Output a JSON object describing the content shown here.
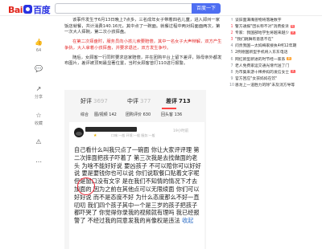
{
  "header": {
    "logo_bai": "Bai",
    "logo_du": "百度",
    "search_button": "百度一下"
  },
  "sidebar": {
    "items": [
      {
        "icon": "like-icon",
        "label": "64"
      },
      {
        "icon": "comment-icon",
        "label": ""
      },
      {
        "icon": "share-icon",
        "label": "分享"
      },
      {
        "icon": "star-icon",
        "label": "收藏"
      },
      {
        "icon": "report-icon",
        "label": ""
      },
      {
        "icon": "more-icon",
        "label": ""
      }
    ]
  },
  "article": {
    "paragraphs": [
      {
        "text": "该事件发生于6月13日晚上7点多，三名成年女子带着四名儿童，进入郑州一家饭店就餐，共计消费140.16元，其中点了一碗面。就餐过程中两对妈面面两次，第一次大人摔碗，第二次小孩摔盘。",
        "red": false
      },
      {
        "text": "在第二次摔盘时，服务员向小孩儿索要赔偿，其中一名女子大声辩解，双方产生争执，大人拿着小孩摔盘，并要求退还，双方发生争吵。",
        "red": true
      },
      {
        "text": "随后，女顾客一行同时要求店家赔偿，并在团购平台上留下差评，除母亲外都发布图片，差评被顶到最显著位置，当时女顾客曾打110进行报警。",
        "red": false
      }
    ]
  },
  "review_panel": {
    "tabs": [
      {
        "label": "好评",
        "count": "3697"
      },
      {
        "label": "中评",
        "count": "377"
      },
      {
        "label": "差评",
        "count": "713"
      }
    ],
    "filters": [
      "综合",
      "图/视频 142",
      "团购评价 630",
      "回头客 136"
    ],
    "review": {
      "stars": "★",
      "meta": "口味:一般 环境:一般 服务:一般",
      "time": "19小时前",
      "body": "自己看什么叫我只点了一碗面 你让大家评评理 第二次摔面把孩子吓着了 第三次我是去找做面的老头 为啥不能好好说 要凶孩子 不可以赔你可以好好说 要是要钱你也可以说 你们说取餐口贴着文字呢 但是窗口没有文字 是在我们不知情的情况下才去加面的 因为之前在其他点可以无限续面 你们可以好好说 而不是态度不好 为什么态度那么不好一直叨叨 我们四个孩子其中一个是三岁的孩子把孩子都吓哭了 你觉得你录我的视频就有理吗 我已经报警了 不经过我的同意发我的肖像权是违法",
      "more": "收起"
    }
  },
  "hot_list": [
    {
      "rank": "",
      "title": "谈旧面满嘴兽物将落难数字",
      "tag": ""
    },
    {
      "rank": "1",
      "title": "警方通报\"团长称不对\"消费投诉",
      "tag": "热"
    },
    {
      "rank": "2",
      "title": "专家：我国部地学生将越来越少",
      "tag": "热"
    },
    {
      "rank": "3",
      "title": "\"我们跳舞有意思不在\"",
      "tag": ""
    },
    {
      "rank": "4",
      "title": "问责我国一太妈梅家接执4柯12年期",
      "tag": ""
    },
    {
      "rank": "5",
      "title": "2例德国新型手机将入东东电话",
      "tag": ""
    },
    {
      "rank": "6",
      "title": "网红新型新进的时节经一家系",
      "tag": "新"
    },
    {
      "rank": "7",
      "title": "老人免费家运交通光增代送了门",
      "tag": ""
    },
    {
      "rank": "8",
      "title": "为市集来游十稀养妈的发信女士",
      "tag": "热"
    },
    {
      "rank": "9",
      "title": "官方回应\"女孩妈妈在饮\"",
      "tag": ""
    },
    {
      "rank": "10",
      "title": "恩龙上一道胜力的除\"未及消方导等",
      "tag": ""
    }
  ]
}
